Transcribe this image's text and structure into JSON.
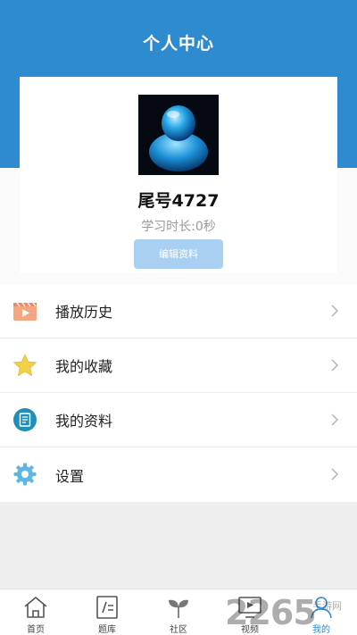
{
  "header": {
    "title": "个人中心"
  },
  "profile": {
    "username": "尾号4727",
    "study_time": "学习时长:0秒",
    "edit_label": "编辑资料"
  },
  "menu": {
    "items": [
      {
        "label": "播放历史",
        "icon": "play-history-icon"
      },
      {
        "label": "我的收藏",
        "icon": "star-icon"
      },
      {
        "label": "我的资料",
        "icon": "document-icon"
      },
      {
        "label": "设置",
        "icon": "gear-icon"
      }
    ]
  },
  "tabbar": {
    "tabs": [
      {
        "label": "首页",
        "icon": "home-icon"
      },
      {
        "label": "题库",
        "icon": "question-bank-icon"
      },
      {
        "label": "社区",
        "icon": "sprout-icon"
      },
      {
        "label": "视频",
        "icon": "video-icon"
      },
      {
        "label": "我的",
        "icon": "user-icon",
        "active": true
      }
    ]
  },
  "watermark": {
    "text": "2265",
    "sub": "手游网"
  },
  "colors": {
    "header": "#2f8bcf",
    "accent": "#2f8bcf",
    "edit_button": "#a9d0f2"
  }
}
